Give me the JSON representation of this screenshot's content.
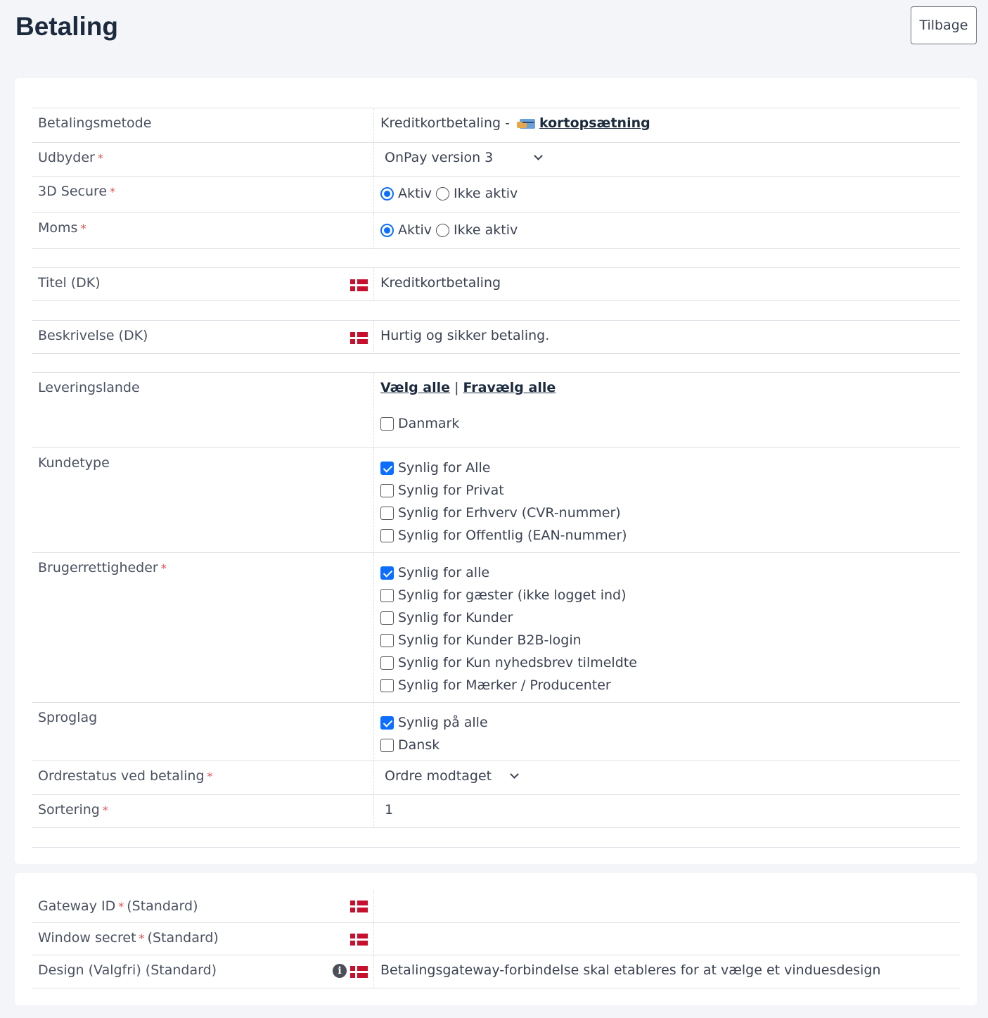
{
  "header": {
    "title": "Betaling",
    "back_label": "Tilbage"
  },
  "form": {
    "payment_method": {
      "label": "Betalingsmetode",
      "value": "Kreditkortbetaling -",
      "link": "kortopsætning",
      "icon": "credit-card-icon"
    },
    "provider": {
      "label": "Udbyder",
      "required": "*",
      "selected": "OnPay version 3"
    },
    "secure3d": {
      "label": "3D Secure",
      "required": "*",
      "options": [
        "Aktiv",
        "Ikke aktiv"
      ],
      "selected": "Aktiv"
    },
    "vat": {
      "label": "Moms",
      "required": "*",
      "options": [
        "Aktiv",
        "Ikke aktiv"
      ],
      "selected": "Aktiv"
    },
    "title": {
      "label": "Titel (DK)",
      "value": "Kreditkortbetaling"
    },
    "description": {
      "label": "Beskrivelse (DK)",
      "value": "Hurtig og sikker betaling."
    },
    "delivery_countries": {
      "label": "Leveringslande",
      "select_all": "Vælg alle",
      "separator": "|",
      "deselect_all": "Fravælg alle",
      "options": [
        {
          "label": "Danmark",
          "checked": false
        }
      ]
    },
    "customer_type": {
      "label": "Kundetype",
      "options": [
        {
          "label": "Synlig for Alle",
          "checked": true
        },
        {
          "label": "Synlig for Privat",
          "checked": false
        },
        {
          "label": "Synlig for Erhverv (CVR-nummer)",
          "checked": false
        },
        {
          "label": "Synlig for Offentlig (EAN-nummer)",
          "checked": false
        }
      ]
    },
    "user_rights": {
      "label": "Brugerrettigheder",
      "required": "*",
      "options": [
        {
          "label": "Synlig for alle",
          "checked": true
        },
        {
          "label": "Synlig for gæster (ikke logget ind)",
          "checked": false
        },
        {
          "label": "Synlig for Kunder",
          "checked": false
        },
        {
          "label": "Synlig for Kunder B2B-login",
          "checked": false
        },
        {
          "label": "Synlig for Kun nyhedsbrev tilmeldte",
          "checked": false
        },
        {
          "label": "Synlig for Mærker / Producenter",
          "checked": false
        }
      ]
    },
    "languages": {
      "label": "Sproglag",
      "options": [
        {
          "label": "Synlig på alle",
          "checked": true
        },
        {
          "label": "Dansk",
          "checked": false
        }
      ]
    },
    "order_status": {
      "label": "Ordrestatus ved betaling",
      "required": "*",
      "selected": "Ordre modtaget"
    },
    "sorting": {
      "label": "Sortering",
      "required": "*",
      "value": "1"
    }
  },
  "gateway": {
    "gateway_id": {
      "label": "Gateway ID",
      "required": "*",
      "suffix": "(Standard)"
    },
    "window_secret": {
      "label": "Window secret",
      "required": "*",
      "suffix": "(Standard)"
    },
    "design": {
      "label": "Design (Valgfri) (Standard)",
      "value": "Betalingsgateway-forbindelse skal etableres for at vælge et vinduesdesign"
    }
  },
  "flag_colors": {
    "red": "#c8102e",
    "white": "#ffffff"
  },
  "accent_color": "#0d6efd"
}
